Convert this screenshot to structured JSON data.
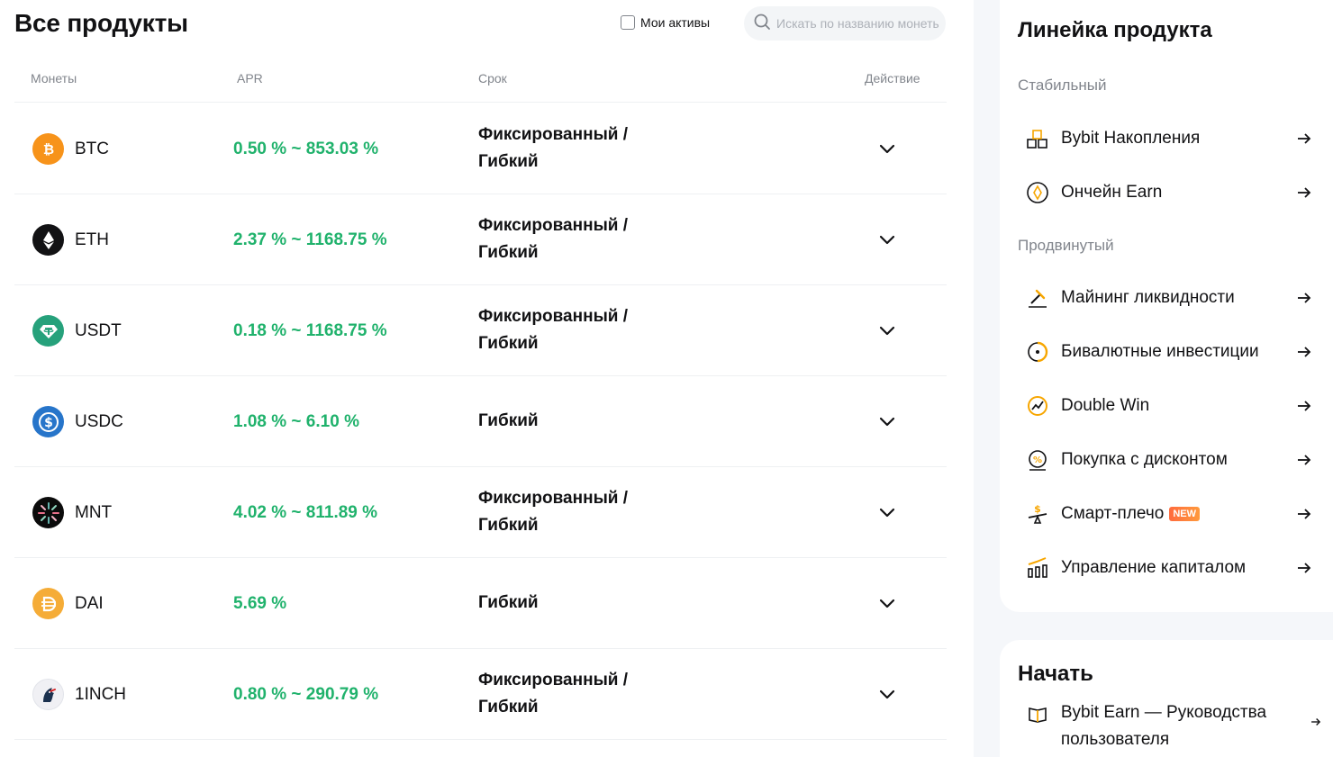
{
  "header": {
    "title": "Все продукты",
    "my_assets_label": "Мои активы",
    "search_placeholder": "Искать по названию монеты"
  },
  "table": {
    "columns": [
      "Монеты",
      "APR",
      "Срок",
      "Действие"
    ],
    "rows": [
      {
        "coin": "BTC",
        "apr": "0.50 % ~ 853.03 %",
        "term_line1": "Фиксированный /",
        "term_line2": "Гибкий"
      },
      {
        "coin": "ETH",
        "apr": "2.37 % ~ 1168.75 %",
        "term_line1": "Фиксированный /",
        "term_line2": "Гибкий"
      },
      {
        "coin": "USDT",
        "apr": "0.18 % ~ 1168.75 %",
        "term_line1": "Фиксированный /",
        "term_line2": "Гибкий"
      },
      {
        "coin": "USDC",
        "apr": "1.08 % ~ 6.10 %",
        "term_line1": "Гибкий",
        "term_line2": ""
      },
      {
        "coin": "MNT",
        "apr": "4.02 % ~ 811.89 %",
        "term_line1": "Фиксированный /",
        "term_line2": "Гибкий"
      },
      {
        "coin": "DAI",
        "apr": "5.69 %",
        "term_line1": "Гибкий",
        "term_line2": ""
      },
      {
        "coin": "1INCH",
        "apr": "0.80 % ~ 290.79 %",
        "term_line1": "Фиксированный /",
        "term_line2": "Гибкий"
      }
    ]
  },
  "sidebar": {
    "lineup_title": "Линейка продукта",
    "stable_label": "Стабильный",
    "stable_items": [
      {
        "label": "Bybit Накопления",
        "icon": "savings-icon"
      },
      {
        "label": "Ончейн Earn",
        "icon": "onchain-icon"
      }
    ],
    "advanced_label": "Продвинутый",
    "advanced_items": [
      {
        "label": "Майнинг ликвидности",
        "icon": "mining-icon"
      },
      {
        "label": "Бивалютные инвестиции",
        "icon": "dual-currency-icon"
      },
      {
        "label": "Double Win",
        "icon": "double-win-icon"
      },
      {
        "label": "Покупка с дисконтом",
        "icon": "discount-icon"
      },
      {
        "label": "Смарт-плечо",
        "icon": "smart-leverage-icon",
        "badge": "NEW"
      },
      {
        "label": "Управление капиталом",
        "icon": "wealth-management-icon"
      }
    ],
    "start_title": "Начать",
    "guide_label": "Bybit Earn — Руководства пользователя"
  },
  "colors": {
    "accent_green": "#20b26c",
    "brand_orange": "#f7a600"
  }
}
